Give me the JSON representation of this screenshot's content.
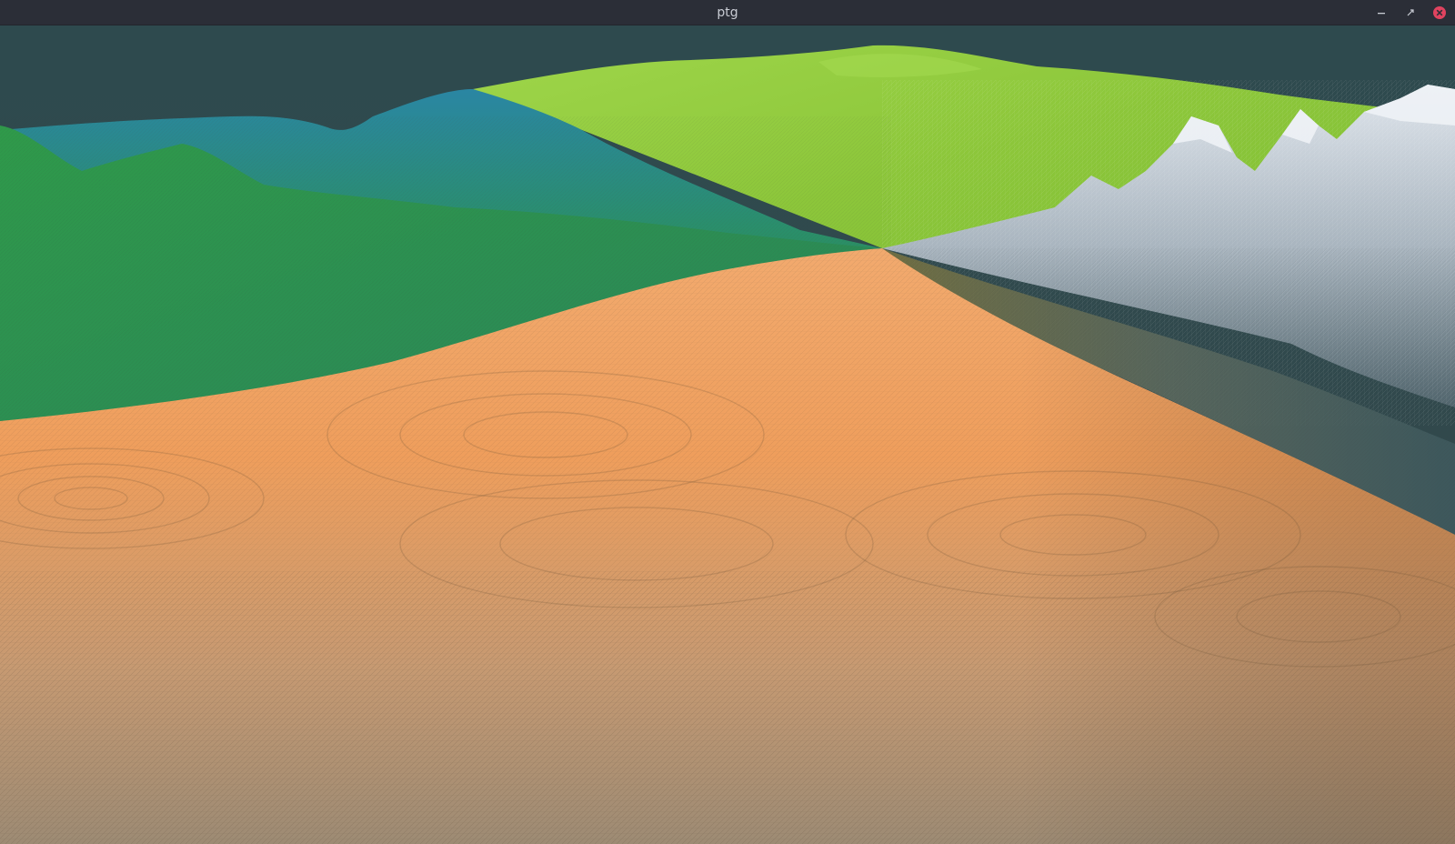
{
  "window": {
    "title": "ptg",
    "controls": {
      "minimize_icon": "minimize-icon",
      "restore_icon": "restore-icon",
      "close_icon": "close-icon"
    },
    "colors": {
      "titlebar": "#2b2e37",
      "title_text": "#c9ccd4",
      "close_button": "#e0435f"
    }
  },
  "scene": {
    "sky_color": "#2f4a4d",
    "biomes": [
      {
        "name": "desert-dunes",
        "color": "#f0a468"
      },
      {
        "name": "lime-hills",
        "color": "#8fcc3a"
      },
      {
        "name": "green-teal-hills",
        "color": "#2e9447"
      },
      {
        "name": "snowy-mountains",
        "color": "#c6cfd8"
      }
    ]
  }
}
